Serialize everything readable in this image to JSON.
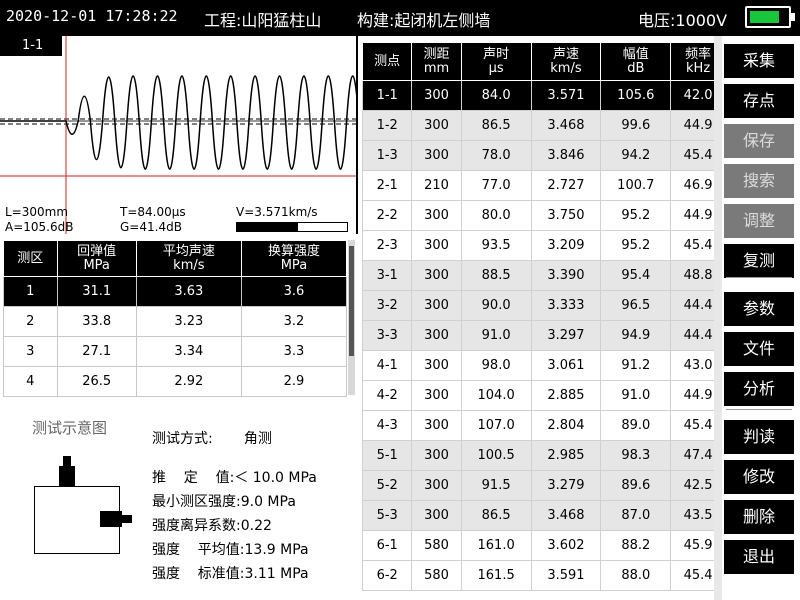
{
  "header": {
    "datetime": "2020-12-01 17:28:22",
    "project": "工程:山阳猛柱山",
    "component": "构建:起闭机左侧墙",
    "voltage": "电压:1000V",
    "battery_level": 0.8,
    "battery_color": "#19c63b"
  },
  "waveform": {
    "label": "1-1",
    "L": "L=300mm",
    "A": "A=105.6dB",
    "T": "T=84.00μs",
    "G": "G=41.4dB",
    "V": "V=3.571km/s",
    "velocity_bar_fraction": 0.55,
    "trace_color": "#000000",
    "cursor_color": "#d22020"
  },
  "region_table": {
    "headers": [
      {
        "line1": "测区",
        "line2": ""
      },
      {
        "line1": "回弹值",
        "line2": "MPa"
      },
      {
        "line1": "平均声速",
        "line2": "km/s"
      },
      {
        "line1": "换算强度",
        "line2": "MPa"
      }
    ],
    "rows": [
      [
        "1",
        "31.1",
        "3.63",
        "3.6"
      ],
      [
        "2",
        "33.8",
        "3.23",
        "3.2"
      ],
      [
        "3",
        "27.1",
        "3.34",
        "3.3"
      ],
      [
        "4",
        "26.5",
        "2.92",
        "2.9"
      ]
    ],
    "selected_row": 0
  },
  "info": {
    "diagram_title": "测试示意图",
    "lines": [
      "测试方式:       角测",
      "推    定    值:＜ 10.0 MPa",
      "最小测区强度:9.0 MPa",
      "强度离异系数:0.22",
      "强度    平均值:13.9 MPa",
      "强度    标准值:3.11 MPa"
    ]
  },
  "main_table": {
    "headers": [
      {
        "line1": "测点",
        "line2": ""
      },
      {
        "line1": "测距",
        "line2": "mm"
      },
      {
        "line1": "声时",
        "line2": "μs"
      },
      {
        "line1": "声速",
        "line2": "km/s"
      },
      {
        "line1": "幅值",
        "line2": "dB"
      },
      {
        "line1": "频率",
        "line2": "kHz"
      }
    ],
    "rows": [
      [
        "1-1",
        "300",
        "84.0",
        "3.571",
        "105.6",
        "42.0"
      ],
      [
        "1-2",
        "300",
        "86.5",
        "3.468",
        "99.6",
        "44.9"
      ],
      [
        "1-3",
        "300",
        "78.0",
        "3.846",
        "94.2",
        "45.4"
      ],
      [
        "2-1",
        "210",
        "77.0",
        "2.727",
        "100.7",
        "46.9"
      ],
      [
        "2-2",
        "300",
        "80.0",
        "3.750",
        "95.2",
        "44.9"
      ],
      [
        "2-3",
        "300",
        "93.5",
        "3.209",
        "95.2",
        "45.4"
      ],
      [
        "3-1",
        "300",
        "88.5",
        "3.390",
        "95.4",
        "48.8"
      ],
      [
        "3-2",
        "300",
        "90.0",
        "3.333",
        "96.5",
        "44.4"
      ],
      [
        "3-3",
        "300",
        "91.0",
        "3.297",
        "94.9",
        "44.4"
      ],
      [
        "4-1",
        "300",
        "98.0",
        "3.061",
        "91.2",
        "43.0"
      ],
      [
        "4-2",
        "300",
        "104.0",
        "2.885",
        "91.0",
        "44.9"
      ],
      [
        "4-3",
        "300",
        "107.0",
        "2.804",
        "89.0",
        "45.4"
      ],
      [
        "5-1",
        "300",
        "100.5",
        "2.985",
        "98.3",
        "47.4"
      ],
      [
        "5-2",
        "300",
        "91.5",
        "3.279",
        "89.6",
        "42.5"
      ],
      [
        "5-3",
        "300",
        "86.5",
        "3.468",
        "87.0",
        "43.5"
      ],
      [
        "6-1",
        "580",
        "161.0",
        "3.602",
        "88.2",
        "45.9"
      ],
      [
        "6-2",
        "580",
        "161.5",
        "3.591",
        "88.0",
        "45.4"
      ]
    ],
    "selected_row": 0
  },
  "sidebar": {
    "buttons": [
      {
        "label": "采集",
        "enabled": true
      },
      {
        "label": "存点",
        "enabled": true
      },
      {
        "label": "保存",
        "enabled": false
      },
      {
        "label": "搜索",
        "enabled": false
      },
      {
        "label": "调整",
        "enabled": false
      },
      {
        "label": "复测",
        "enabled": true
      },
      {
        "label": "参数",
        "enabled": true
      },
      {
        "label": "文件",
        "enabled": true
      },
      {
        "label": "分析",
        "enabled": true
      },
      {
        "label": "判读",
        "enabled": true
      },
      {
        "label": "修改",
        "enabled": true
      },
      {
        "label": "删除",
        "enabled": true
      },
      {
        "label": "退出",
        "enabled": true
      }
    ]
  }
}
